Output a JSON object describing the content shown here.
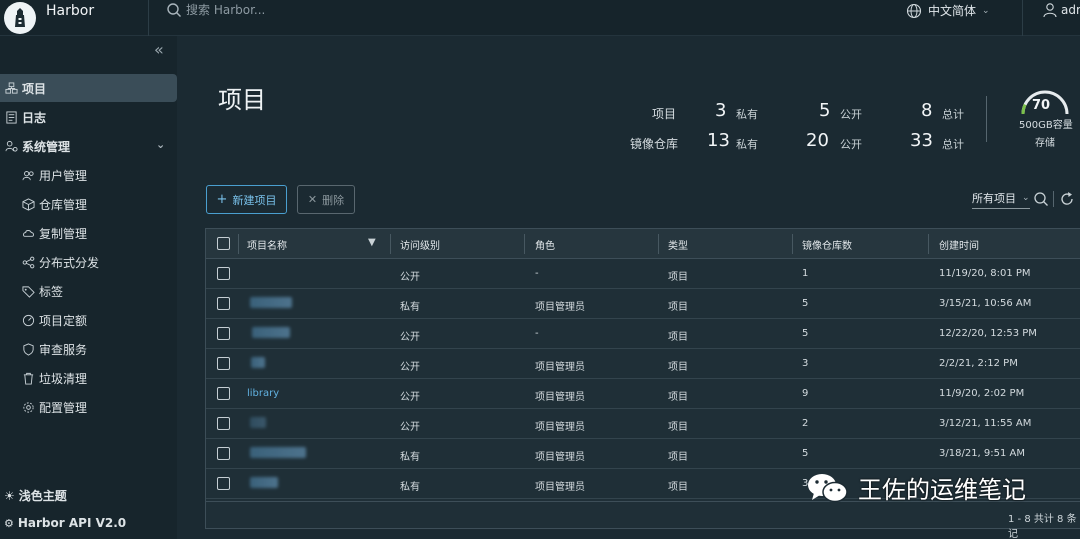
{
  "header": {
    "app_title": "Harbor",
    "search_placeholder": "搜索 Harbor...",
    "language": "中文简体",
    "user": "adm"
  },
  "sidebar": {
    "items": [
      {
        "label": "项目",
        "icon": "projects-icon",
        "active": true
      },
      {
        "label": "日志",
        "icon": "logs-icon"
      },
      {
        "label": "系统管理",
        "icon": "admin-icon",
        "expanded": true
      },
      {
        "label": "用户管理",
        "icon": "users-icon"
      },
      {
        "label": "仓库管理",
        "icon": "registry-icon"
      },
      {
        "label": "复制管理",
        "icon": "replication-icon"
      },
      {
        "label": "分布式分发",
        "icon": "distribution-icon"
      },
      {
        "label": "标签",
        "icon": "tag-icon"
      },
      {
        "label": "项目定额",
        "icon": "quota-icon"
      },
      {
        "label": "审查服务",
        "icon": "shield-icon"
      },
      {
        "label": "垃圾清理",
        "icon": "trash-icon"
      },
      {
        "label": "配置管理",
        "icon": "gear-icon"
      }
    ],
    "theme_toggle": "浅色主题",
    "api_link": "Harbor API V2.0"
  },
  "main": {
    "title": "项目",
    "stats": {
      "projects_label": "项目",
      "repos_label": "镜像仓库",
      "private_label": "私有",
      "public_label": "公开",
      "total_label": "总计",
      "projects": {
        "private": "3",
        "public": "5",
        "total": "8"
      },
      "repos": {
        "private": "13",
        "public": "20",
        "total": "33"
      }
    },
    "storage": {
      "value": "70",
      "capacity": "500GB容量",
      "label": "存储",
      "fraction": 0.14
    },
    "buttons": {
      "new_project": "新建项目",
      "delete": "删除"
    },
    "filter": "所有项目"
  },
  "table": {
    "columns": [
      "项目名称",
      "访问级别",
      "角色",
      "类型",
      "镜像仓库数",
      "创建时间"
    ],
    "rows": [
      {
        "name": "",
        "access": "公开",
        "role": "-",
        "type": "项目",
        "repos": "1",
        "created": "11/19/20, 8:01 PM"
      },
      {
        "name": "",
        "access": "私有",
        "role": "项目管理员",
        "type": "项目",
        "repos": "5",
        "created": "3/15/21, 10:56 AM"
      },
      {
        "name": "",
        "access": "公开",
        "role": "-",
        "type": "项目",
        "repos": "5",
        "created": "12/22/20, 12:53 PM"
      },
      {
        "name": "",
        "access": "公开",
        "role": "项目管理员",
        "type": "项目",
        "repos": "3",
        "created": "2/2/21, 2:12 PM"
      },
      {
        "name": "library",
        "access": "公开",
        "role": "项目管理员",
        "type": "项目",
        "repos": "9",
        "created": "11/9/20, 2:02 PM"
      },
      {
        "name": "",
        "access": "公开",
        "role": "项目管理员",
        "type": "项目",
        "repos": "2",
        "created": "3/12/21, 11:55 AM"
      },
      {
        "name": "",
        "access": "私有",
        "role": "项目管理员",
        "type": "项目",
        "repos": "5",
        "created": "3/18/21, 9:51 AM"
      },
      {
        "name": "",
        "access": "私有",
        "role": "项目管理员",
        "type": "项目",
        "repos": "3",
        "created": ""
      }
    ],
    "pagination": "1 - 8 共计 8 条记"
  },
  "watermark": "王佐的运维笔记",
  "colors": {
    "accent": "#4a9fd0",
    "link": "#61b1e0",
    "gauge": "#7bc04a"
  }
}
